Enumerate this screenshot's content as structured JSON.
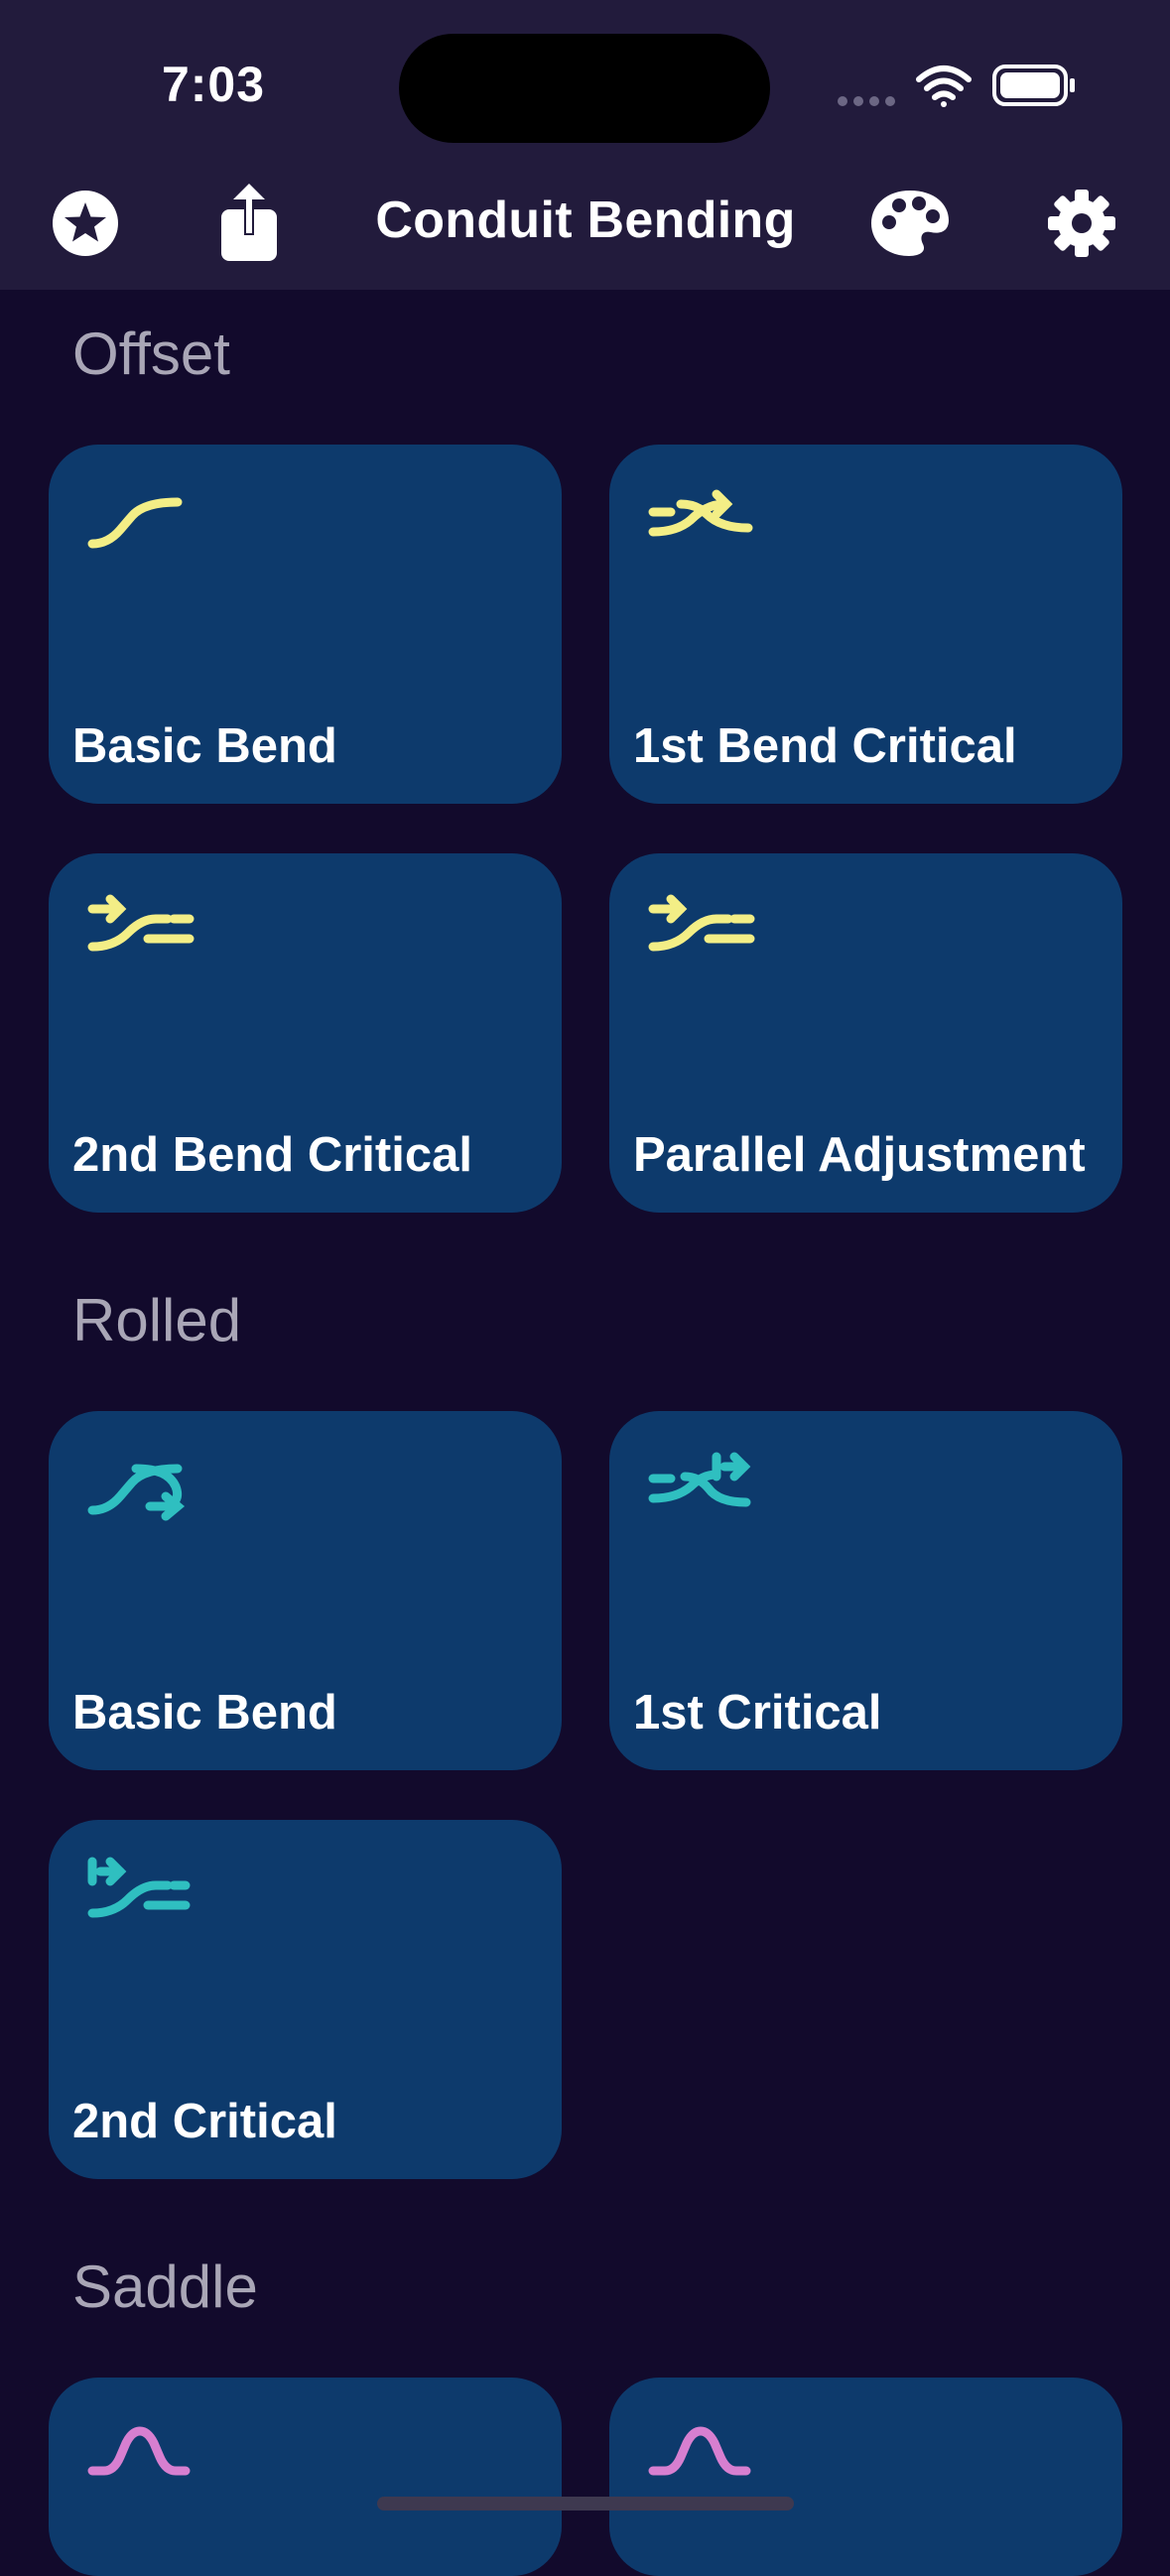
{
  "status_bar": {
    "time": "7:03"
  },
  "nav": {
    "title": "Conduit Bending",
    "left_icons": [
      "star-circle-icon",
      "share-icon"
    ],
    "right_icons": [
      "palette-icon",
      "gear-icon"
    ]
  },
  "colors": {
    "background": "#120a2c",
    "tile": "#0d3a6c",
    "offset_icon": "#f3ee86",
    "rolled_icon": "#2fbfc0",
    "saddle_icon": "#d77fd0"
  },
  "sections": [
    {
      "title": "Offset",
      "items": [
        {
          "label": "Basic Bend",
          "icon": "offset-basic-icon"
        },
        {
          "label": "1st Bend Critical",
          "icon": "offset-first-critical-icon"
        },
        {
          "label": "2nd Bend Critical",
          "icon": "offset-second-critical-icon"
        },
        {
          "label": "Parallel Adjustment",
          "icon": "offset-parallel-icon"
        }
      ]
    },
    {
      "title": "Rolled",
      "items": [
        {
          "label": "Basic Bend",
          "icon": "rolled-basic-icon"
        },
        {
          "label": "1st Critical",
          "icon": "rolled-first-critical-icon"
        },
        {
          "label": "2nd Critical",
          "icon": "rolled-second-critical-icon"
        }
      ]
    },
    {
      "title": "Saddle",
      "items": [
        {
          "label": "",
          "icon": "saddle-icon"
        },
        {
          "label": "",
          "icon": "saddle-icon"
        }
      ]
    }
  ]
}
